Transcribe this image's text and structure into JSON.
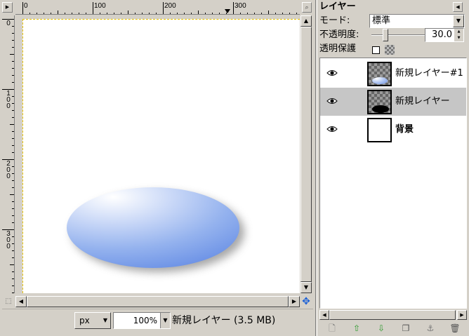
{
  "image_window": {
    "menu_button_icon": "triangle-right-icon",
    "zoom_toggle_icon": "zoom-fit-icon",
    "hruler_labels": [
      "0",
      "100",
      "200",
      "300"
    ],
    "vruler_labels": [
      [
        "0"
      ],
      [
        "1",
        "0",
        "0"
      ],
      [
        "2",
        "0",
        "0"
      ],
      [
        "3",
        "0",
        "0"
      ]
    ],
    "status": {
      "unit": "px",
      "zoom": "100%",
      "message": "新規レイヤー (3.5 MB)"
    },
    "canvas_guide_color": "#e6c200",
    "ellipse_colors": [
      "#ffffff",
      "#c8d7f7",
      "#94b2ee",
      "#6c92e6"
    ]
  },
  "layers_dock": {
    "title": "レイヤー",
    "mode_label": "モード:",
    "mode_value": "標準",
    "opacity_label": "不透明度:",
    "opacity_value": "30.0",
    "opacity_fraction": 0.3,
    "lock_label": "透明保護",
    "lock_checked": false,
    "layers": [
      {
        "name": "新規レイヤー#1",
        "visible": true,
        "selected": false,
        "thumb": "gradient-ellipse",
        "bold": false
      },
      {
        "name": "新規レイヤー",
        "visible": true,
        "selected": true,
        "thumb": "black-shadow-ellipse",
        "bold": false
      },
      {
        "name": "背景",
        "visible": true,
        "selected": false,
        "thumb": "white-fill",
        "bold": true
      }
    ],
    "buttons": [
      {
        "icon": "new-layer-icon",
        "glyph": "🗋",
        "color": "#777777"
      },
      {
        "icon": "raise-layer-icon",
        "glyph": "⇧",
        "color": "#2e9a2e"
      },
      {
        "icon": "lower-layer-icon",
        "glyph": "⇩",
        "color": "#2e9a2e"
      },
      {
        "icon": "duplicate-layer-icon",
        "glyph": "❐",
        "color": "#555555"
      },
      {
        "icon": "anchor-layer-icon",
        "glyph": "⚓",
        "color": "#777777"
      },
      {
        "icon": "delete-layer-icon",
        "glyph": "🗑",
        "color": "#555555"
      }
    ]
  }
}
